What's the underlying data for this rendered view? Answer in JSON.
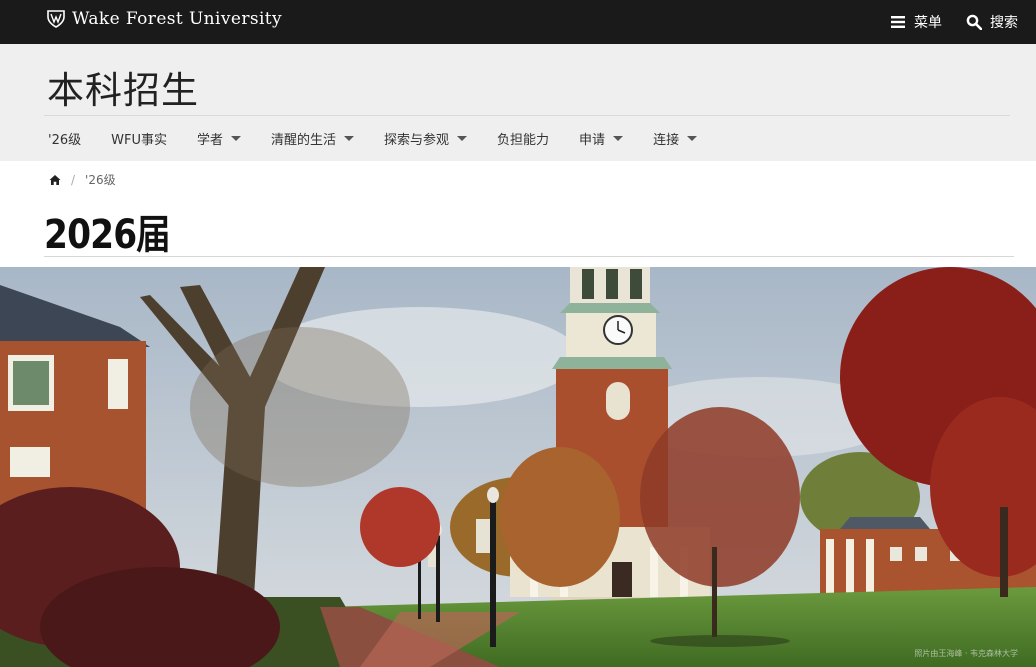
{
  "topbar": {
    "brand": "Wake Forest University",
    "menu_label": "菜单",
    "search_label": "搜索"
  },
  "header": {
    "site_title": "本科招生",
    "nav": [
      {
        "label": "'26级",
        "has_dropdown": false
      },
      {
        "label": "WFU事实",
        "has_dropdown": false
      },
      {
        "label": "学者",
        "has_dropdown": true
      },
      {
        "label": "清醒的生活",
        "has_dropdown": true
      },
      {
        "label": "探索与参观",
        "has_dropdown": true
      },
      {
        "label": "负担能力",
        "has_dropdown": false
      },
      {
        "label": "申请",
        "has_dropdown": true
      },
      {
        "label": "连接",
        "has_dropdown": true
      }
    ]
  },
  "breadcrumb": {
    "current": "'26级"
  },
  "page": {
    "title": "2026届"
  },
  "hero": {
    "credit": "照片由王海峰 · 韦克森林大学"
  },
  "colors": {
    "topbar_bg": "#1a1a1a",
    "header_bg": "#efefef",
    "text_dark": "#222222"
  }
}
